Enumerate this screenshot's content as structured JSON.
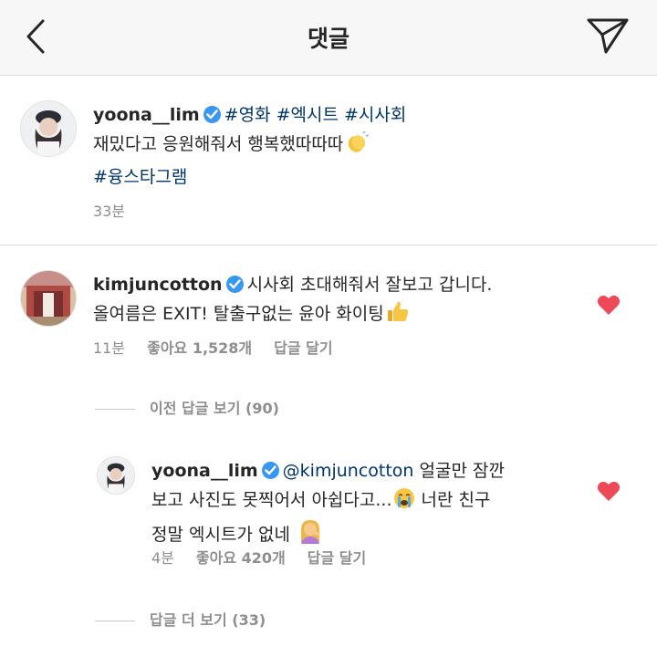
{
  "header": {
    "title": "댓글",
    "back_icon": "chevron-left-icon",
    "send_icon": "paper-plane-icon"
  },
  "caption": {
    "username": "yoona__lim",
    "tags": "#영화 #엑시트 #시사회",
    "text": "재밌다고 응원해줘서 행복했따따따",
    "emoji": "clapping-hands",
    "hashtag": "#융스타그램",
    "time": "33분"
  },
  "comments": [
    {
      "username": "kimjuncotton",
      "text_line1": "시사회 초대해줘서 잘보고 갑니다.",
      "text_line2": "올여름은 EXIT! 탈출구없는 윤아 화이팅",
      "emoji": "thumbs-up",
      "time": "11분",
      "likes": "좋아요 1,528개",
      "reply_label": "답글 달기",
      "liked": true
    }
  ],
  "view_previous_replies": "이전 답글 보기 (90)",
  "reply": {
    "username": "yoona__lim",
    "mention": "@kimjuncotton",
    "text_line1_rest": "얼굴만 잠깐",
    "text_line2": "보고 사진도 못찍어서 아쉽다고...",
    "emoji1": "crying-face",
    "text_line2_rest": "너란 친구",
    "text_line3": "정말 엑시트가 없네",
    "emoji2": "person-tipping-hand",
    "time": "4분",
    "likes": "좋아요 420개",
    "reply_label": "답글 달기",
    "liked": true
  },
  "view_more_replies": "답글 더 보기 (33)",
  "colors": {
    "heart": "#ed4956",
    "verified": "#3897f0",
    "hashtag": "#003569",
    "meta": "#8e8e8e"
  }
}
